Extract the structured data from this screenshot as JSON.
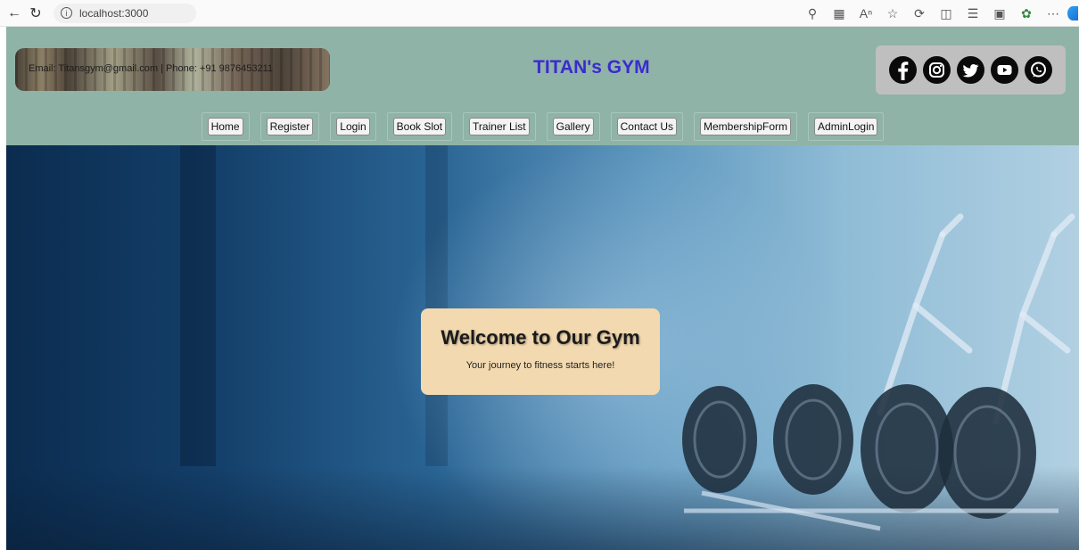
{
  "browser": {
    "url": "localhost:3000"
  },
  "header": {
    "contact_text": "Email: Titansgym@gmail.com | Phone: +91 9876453211",
    "site_title": "TITAN's GYM",
    "social_icons": [
      "facebook-icon",
      "instagram-icon",
      "twitter-icon",
      "youtube-icon",
      "whatsapp-icon"
    ]
  },
  "menu": {
    "items": [
      {
        "label": "Home"
      },
      {
        "label": "Register"
      },
      {
        "label": "Login"
      },
      {
        "label": "Book Slot"
      },
      {
        "label": "Trainer List"
      },
      {
        "label": "Gallery"
      },
      {
        "label": "Contact Us"
      },
      {
        "label": "MembershipForm"
      },
      {
        "label": "AdminLogin"
      }
    ]
  },
  "hero": {
    "title": "Welcome to Our Gym",
    "subtitle": "Your journey to fitness starts here!"
  },
  "colors": {
    "header_bg": "#8fb3a6",
    "title_color": "#3a2bd1",
    "welcome_bg": "#f2d9b0"
  }
}
